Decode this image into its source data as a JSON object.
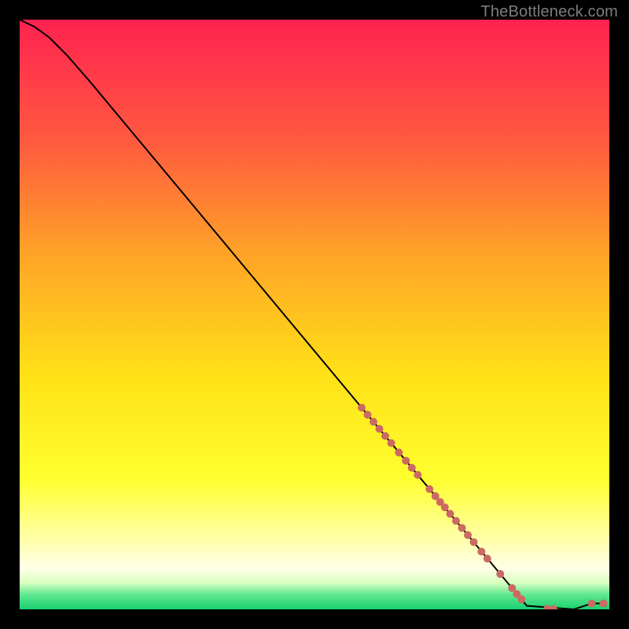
{
  "attribution": "TheBottleneck.com",
  "colors": {
    "curve": "#000000",
    "marker_fill": "#cb6a62",
    "marker_stroke": "#b94f47"
  },
  "chart_data": {
    "type": "line",
    "title": "",
    "xlabel": "",
    "ylabel": "",
    "xlim": [
      0,
      100
    ],
    "ylim": [
      0,
      100
    ],
    "grid": false,
    "legend": false,
    "background_gradient": [
      {
        "pos": 0.0,
        "color": "#ff2250"
      },
      {
        "pos": 0.2,
        "color": "#ff5840"
      },
      {
        "pos": 0.4,
        "color": "#ffa427"
      },
      {
        "pos": 0.6,
        "color": "#ffe016"
      },
      {
        "pos": 0.78,
        "color": "#ffff2f"
      },
      {
        "pos": 0.88,
        "color": "#ffffa8"
      },
      {
        "pos": 0.93,
        "color": "#ffffe8"
      },
      {
        "pos": 0.955,
        "color": "#d8ffc0"
      },
      {
        "pos": 0.975,
        "color": "#60e890"
      },
      {
        "pos": 1.0,
        "color": "#18d070"
      }
    ],
    "curve": [
      {
        "x": 0.0,
        "y": 100.0
      },
      {
        "x": 2.5,
        "y": 98.8
      },
      {
        "x": 5.0,
        "y": 97.0
      },
      {
        "x": 8.0,
        "y": 94.0
      },
      {
        "x": 12.0,
        "y": 89.4
      },
      {
        "x": 20.0,
        "y": 79.8
      },
      {
        "x": 30.0,
        "y": 67.8
      },
      {
        "x": 40.0,
        "y": 55.8
      },
      {
        "x": 50.0,
        "y": 43.8
      },
      {
        "x": 60.0,
        "y": 31.8
      },
      {
        "x": 70.0,
        "y": 19.8
      },
      {
        "x": 80.0,
        "y": 7.8
      },
      {
        "x": 86.0,
        "y": 0.6
      },
      {
        "x": 94.0,
        "y": 0.0
      },
      {
        "x": 97.0,
        "y": 1.0
      },
      {
        "x": 99.0,
        "y": 1.0
      }
    ],
    "markers": [
      {
        "x": 58.0,
        "y": 34.2,
        "r": 5
      },
      {
        "x": 59.0,
        "y": 33.0,
        "r": 5
      },
      {
        "x": 60.0,
        "y": 31.8,
        "r": 5
      },
      {
        "x": 61.0,
        "y": 30.6,
        "r": 5
      },
      {
        "x": 62.0,
        "y": 29.4,
        "r": 5
      },
      {
        "x": 63.0,
        "y": 28.2,
        "r": 5
      },
      {
        "x": 64.3,
        "y": 26.6,
        "r": 5
      },
      {
        "x": 65.5,
        "y": 25.2,
        "r": 5
      },
      {
        "x": 66.5,
        "y": 24.0,
        "r": 5
      },
      {
        "x": 67.5,
        "y": 22.8,
        "r": 5
      },
      {
        "x": 69.5,
        "y": 20.4,
        "r": 5
      },
      {
        "x": 70.5,
        "y": 19.2,
        "r": 5
      },
      {
        "x": 71.3,
        "y": 18.2,
        "r": 5
      },
      {
        "x": 72.1,
        "y": 17.3,
        "r": 5
      },
      {
        "x": 73.0,
        "y": 16.2,
        "r": 5
      },
      {
        "x": 74.0,
        "y": 15.0,
        "r": 5
      },
      {
        "x": 75.0,
        "y": 13.8,
        "r": 5
      },
      {
        "x": 76.0,
        "y": 12.6,
        "r": 5
      },
      {
        "x": 77.0,
        "y": 11.4,
        "r": 5
      },
      {
        "x": 78.3,
        "y": 9.8,
        "r": 5
      },
      {
        "x": 79.3,
        "y": 8.6,
        "r": 5
      },
      {
        "x": 81.5,
        "y": 6.0,
        "r": 5
      },
      {
        "x": 83.5,
        "y": 3.6,
        "r": 5
      },
      {
        "x": 84.3,
        "y": 2.6,
        "r": 5
      },
      {
        "x": 85.1,
        "y": 1.7,
        "r": 5
      },
      {
        "x": 89.5,
        "y": 0.1,
        "r": 5
      },
      {
        "x": 90.5,
        "y": 0.05,
        "r": 5
      },
      {
        "x": 97.0,
        "y": 1.0,
        "r": 5
      },
      {
        "x": 99.0,
        "y": 1.0,
        "r": 5
      }
    ]
  }
}
